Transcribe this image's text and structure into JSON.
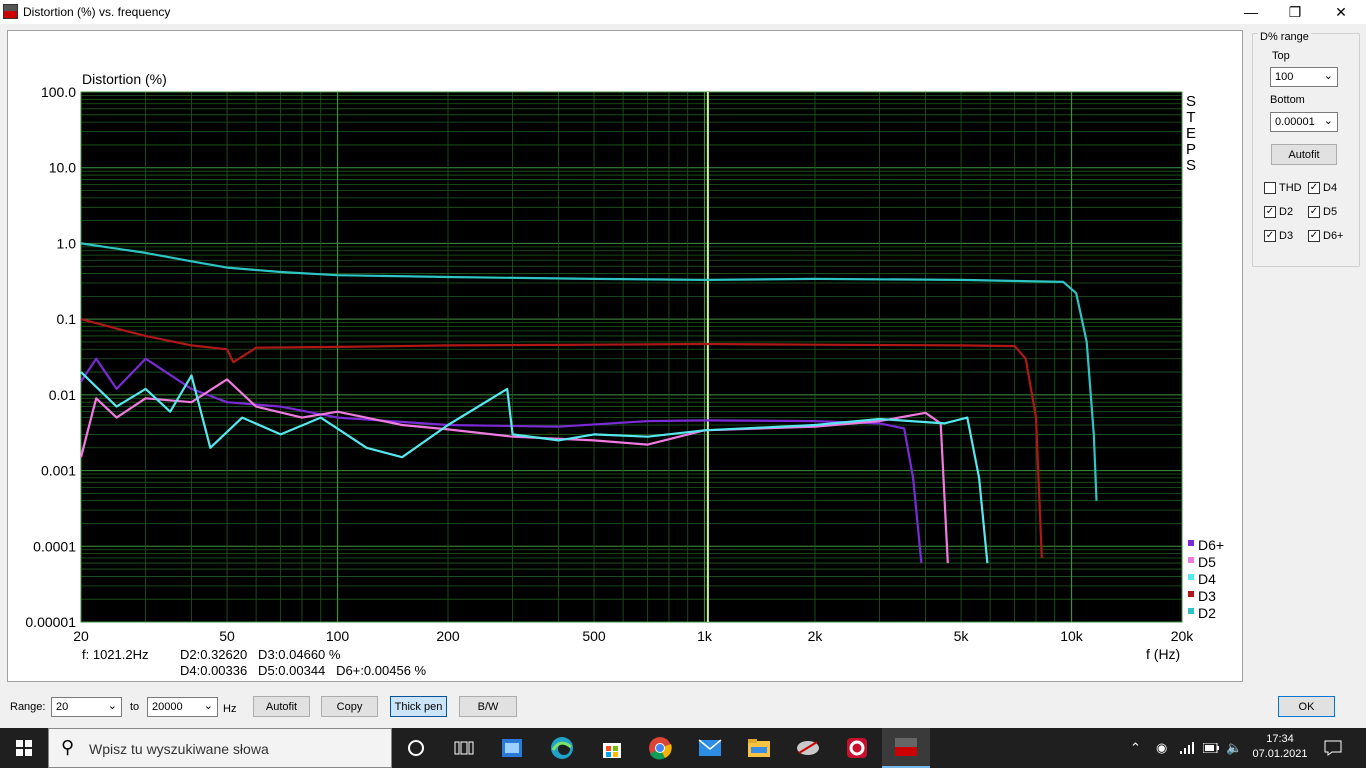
{
  "window": {
    "title": "Distortion (%) vs. frequency",
    "app_name": "Steps"
  },
  "plot": {
    "ylabel": "Distortion (%)",
    "xlabel": "f (Hz)",
    "side_label": [
      "S",
      "T",
      "E",
      "P",
      "S"
    ],
    "y_ticks": [
      "100.0",
      "10.0",
      "1.0",
      "0.1",
      "0.01",
      "0.001",
      "0.0001",
      "0.00001"
    ],
    "x_ticks": [
      "20",
      "50",
      "100",
      "200",
      "500",
      "1k",
      "2k",
      "5k",
      "10k",
      "20k"
    ],
    "cursor_readout": {
      "freq": "f: 1021.2Hz",
      "line1": "D2:0.32620   D3:0.04660 %",
      "line2": "D4:0.00336   D5:0.00344   D6+:0.00456 %"
    },
    "legend": [
      {
        "name": "D6+",
        "color": "#7a2bd6"
      },
      {
        "name": "D5",
        "color": "#f07ae0"
      },
      {
        "name": "D4",
        "color": "#55e8f0"
      },
      {
        "name": "D3",
        "color": "#b01818"
      },
      {
        "name": "D2",
        "color": "#2ec4c4"
      }
    ]
  },
  "chart_data": {
    "type": "line",
    "x_scale": "log",
    "y_scale": "log",
    "xlim": [
      20,
      20000
    ],
    "ylim": [
      1e-05,
      100
    ],
    "cursor_x": 1021.2,
    "background": "#000000",
    "grid": true,
    "legend_position": "bottom-right",
    "series": [
      {
        "name": "D2",
        "color": "#2ec4c4",
        "points": [
          [
            20,
            1.0
          ],
          [
            30,
            0.75
          ],
          [
            40,
            0.58
          ],
          [
            50,
            0.48
          ],
          [
            70,
            0.42
          ],
          [
            100,
            0.38
          ],
          [
            200,
            0.36
          ],
          [
            500,
            0.34
          ],
          [
            1000,
            0.33
          ],
          [
            2000,
            0.34
          ],
          [
            5000,
            0.33
          ],
          [
            9500,
            0.31
          ],
          [
            10300,
            0.22
          ],
          [
            11000,
            0.05
          ],
          [
            11500,
            0.003
          ],
          [
            11700,
            0.0004
          ]
        ]
      },
      {
        "name": "D3",
        "color": "#b01818",
        "points": [
          [
            20,
            0.1
          ],
          [
            25,
            0.075
          ],
          [
            30,
            0.06
          ],
          [
            40,
            0.045
          ],
          [
            50,
            0.04
          ],
          [
            52,
            0.027
          ],
          [
            60,
            0.042
          ],
          [
            100,
            0.043
          ],
          [
            200,
            0.045
          ],
          [
            500,
            0.046
          ],
          [
            1000,
            0.047
          ],
          [
            2000,
            0.046
          ],
          [
            5000,
            0.045
          ],
          [
            7000,
            0.044
          ],
          [
            7500,
            0.03
          ],
          [
            8000,
            0.005
          ],
          [
            8300,
            7e-05
          ]
        ]
      },
      {
        "name": "D4",
        "color": "#55e8f0",
        "points": [
          [
            20,
            0.02
          ],
          [
            25,
            0.007
          ],
          [
            30,
            0.012
          ],
          [
            35,
            0.006
          ],
          [
            40,
            0.018
          ],
          [
            45,
            0.002
          ],
          [
            55,
            0.005
          ],
          [
            70,
            0.003
          ],
          [
            90,
            0.005
          ],
          [
            120,
            0.002
          ],
          [
            150,
            0.0015
          ],
          [
            200,
            0.004
          ],
          [
            290,
            0.012
          ],
          [
            300,
            0.003
          ],
          [
            400,
            0.0025
          ],
          [
            500,
            0.003
          ],
          [
            700,
            0.0028
          ],
          [
            1000,
            0.0034
          ],
          [
            2000,
            0.004
          ],
          [
            3000,
            0.0048
          ],
          [
            4500,
            0.0042
          ],
          [
            5200,
            0.005
          ],
          [
            5600,
            0.0008
          ],
          [
            5900,
            6e-05
          ]
        ]
      },
      {
        "name": "D5",
        "color": "#f07ae0",
        "points": [
          [
            20,
            0.0015
          ],
          [
            22,
            0.009
          ],
          [
            25,
            0.005
          ],
          [
            30,
            0.009
          ],
          [
            40,
            0.008
          ],
          [
            50,
            0.016
          ],
          [
            60,
            0.007
          ],
          [
            80,
            0.005
          ],
          [
            100,
            0.006
          ],
          [
            150,
            0.004
          ],
          [
            200,
            0.0035
          ],
          [
            300,
            0.0028
          ],
          [
            500,
            0.0025
          ],
          [
            700,
            0.0022
          ],
          [
            1000,
            0.0034
          ],
          [
            2000,
            0.0038
          ],
          [
            3000,
            0.0045
          ],
          [
            4000,
            0.0058
          ],
          [
            4400,
            0.0042
          ],
          [
            4600,
            6e-05
          ]
        ]
      },
      {
        "name": "D6+",
        "color": "#7a2bd6",
        "points": [
          [
            20,
            0.015
          ],
          [
            22,
            0.03
          ],
          [
            25,
            0.012
          ],
          [
            30,
            0.03
          ],
          [
            40,
            0.012
          ],
          [
            50,
            0.008
          ],
          [
            70,
            0.007
          ],
          [
            100,
            0.005
          ],
          [
            200,
            0.004
          ],
          [
            400,
            0.0038
          ],
          [
            700,
            0.0045
          ],
          [
            1000,
            0.0046
          ],
          [
            2000,
            0.0045
          ],
          [
            3000,
            0.0042
          ],
          [
            3500,
            0.0036
          ],
          [
            3700,
            0.0008
          ],
          [
            3900,
            6e-05
          ]
        ]
      }
    ]
  },
  "panel": {
    "title": "D% range",
    "top_label": "Top",
    "top_value": "100",
    "bottom_label": "Bottom",
    "bottom_value": "0.00001",
    "autofit_label": "Autofit",
    "checks": [
      {
        "label": "THD",
        "checked": false
      },
      {
        "label": "D4",
        "checked": true
      },
      {
        "label": "D2",
        "checked": true
      },
      {
        "label": "D5",
        "checked": true
      },
      {
        "label": "D3",
        "checked": true
      },
      {
        "label": "D6+",
        "checked": true
      }
    ]
  },
  "bottom": {
    "range_label": "Range:",
    "range_from": "20",
    "to_label": "to",
    "range_to": "20000",
    "hz_label": "Hz",
    "autofit_label": "Autofit",
    "copy_label": "Copy",
    "thickpen_label": "Thick pen",
    "bw_label": "B/W",
    "ok_label": "OK"
  },
  "taskbar": {
    "search_placeholder": "Wpisz tu wyszukiwane słowa",
    "time": "17:34",
    "date": "07.01.2021"
  }
}
